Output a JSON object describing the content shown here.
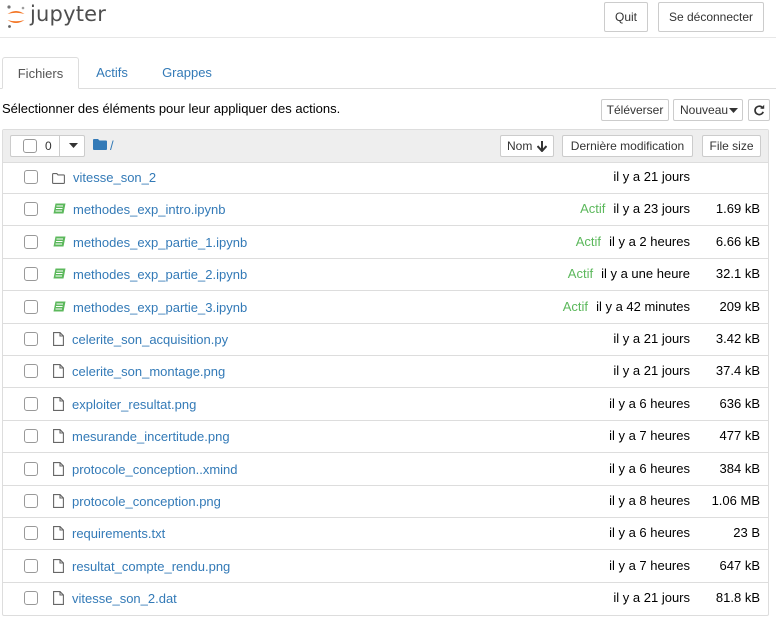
{
  "header": {
    "logo_text": "jupyter",
    "quit_label": "Quit",
    "logout_label": "Se déconnecter"
  },
  "tabs": [
    {
      "label": "Fichiers"
    },
    {
      "label": "Actifs"
    },
    {
      "label": "Grappes"
    }
  ],
  "toolbar": {
    "select_text": "Sélectionner des éléments pour leur appliquer des actions.",
    "upload_label": "Téléverser",
    "new_label": "Nouveau"
  },
  "list_header": {
    "selected_count": "0",
    "path": "/",
    "sort_name_label": "Nom",
    "sort_modified_label": "Dernière modification",
    "sort_size_label": "File size"
  },
  "files": [
    {
      "name": "vitesse_son_2",
      "type": "folder",
      "status": "",
      "modified": "il y a 21 jours",
      "size": ""
    },
    {
      "name": "methodes_exp_intro.ipynb",
      "type": "notebook",
      "status": "Actif",
      "modified": "il y a 23 jours",
      "size": "1.69 kB"
    },
    {
      "name": "methodes_exp_partie_1.ipynb",
      "type": "notebook",
      "status": "Actif",
      "modified": "il y a 2 heures",
      "size": "6.66 kB"
    },
    {
      "name": "methodes_exp_partie_2.ipynb",
      "type": "notebook",
      "status": "Actif",
      "modified": "il y a une heure",
      "size": "32.1 kB"
    },
    {
      "name": "methodes_exp_partie_3.ipynb",
      "type": "notebook",
      "status": "Actif",
      "modified": "il y a 42 minutes",
      "size": "209 kB"
    },
    {
      "name": "celerite_son_acquisition.py",
      "type": "file",
      "status": "",
      "modified": "il y a 21 jours",
      "size": "3.42 kB"
    },
    {
      "name": "celerite_son_montage.png",
      "type": "file",
      "status": "",
      "modified": "il y a 21 jours",
      "size": "37.4 kB"
    },
    {
      "name": "exploiter_resultat.png",
      "type": "file",
      "status": "",
      "modified": "il y a 6 heures",
      "size": "636 kB"
    },
    {
      "name": "mesurande_incertitude.png",
      "type": "file",
      "status": "",
      "modified": "il y a 7 heures",
      "size": "477 kB"
    },
    {
      "name": "protocole_conception..xmind",
      "type": "file",
      "status": "",
      "modified": "il y a 6 heures",
      "size": "384 kB"
    },
    {
      "name": "protocole_conception.png",
      "type": "file",
      "status": "",
      "modified": "il y a 8 heures",
      "size": "1.06 MB"
    },
    {
      "name": "requirements.txt",
      "type": "file",
      "status": "",
      "modified": "il y a 6 heures",
      "size": "23 B"
    },
    {
      "name": "resultat_compte_rendu.png",
      "type": "file",
      "status": "",
      "modified": "il y a 7 heures",
      "size": "647 kB"
    },
    {
      "name": "vitesse_son_2.dat",
      "type": "file",
      "status": "",
      "modified": "il y a 21 jours",
      "size": "81.8 kB"
    }
  ],
  "colors": {
    "link": "#337ab7",
    "active_status": "#5cb85c",
    "notebook_icon": "#5cb85c",
    "folder_icon": "#337ab7",
    "logo_orange": "#f37626"
  }
}
